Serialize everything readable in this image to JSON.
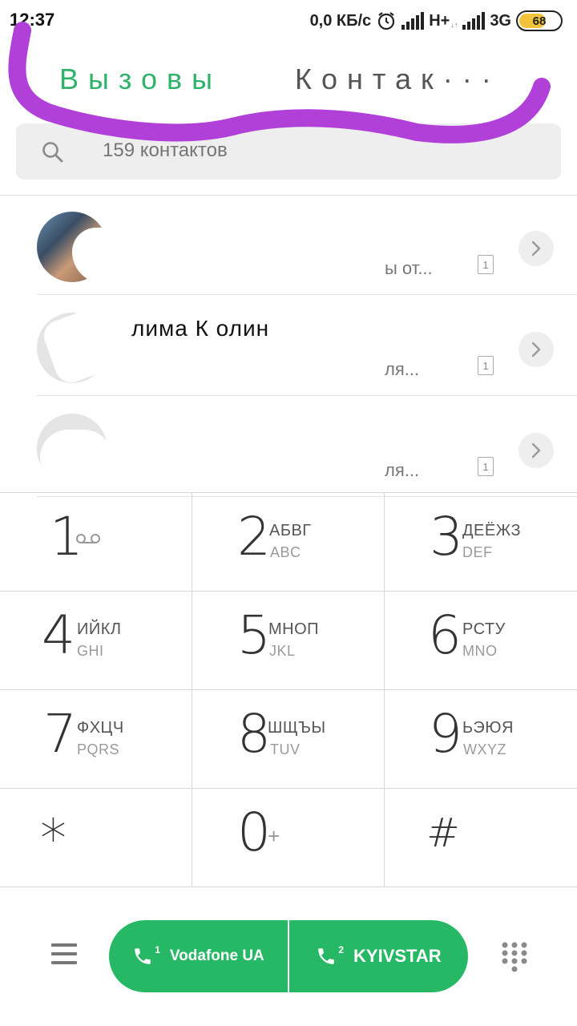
{
  "status_bar": {
    "time": "12:37",
    "speed": "0,0 КБ/с",
    "net1": "H+",
    "net2": "3G",
    "battery_level": 68
  },
  "tabs": [
    {
      "label": "Вызовы",
      "active": true
    },
    {
      "label": "Контак···",
      "active": false
    }
  ],
  "search": {
    "placeholder": "159 контактов"
  },
  "contacts": [
    {
      "name": "",
      "subtitle": "ы от...",
      "sim": "1",
      "avatar": "photo"
    },
    {
      "name": "лима К   олин",
      "subtitle": "ля...",
      "sim": "1",
      "avatar": "blank"
    },
    {
      "name": "",
      "subtitle": "ля...",
      "sim": "1",
      "avatar": "blank"
    }
  ],
  "dialpad": [
    {
      "digit": "1",
      "letters": "",
      "latin": "",
      "icon": "voicemail-icon"
    },
    {
      "digit": "2",
      "letters": "АБВГ",
      "latin": "ABC"
    },
    {
      "digit": "3",
      "letters": "ДЕЁЖЗ",
      "latin": "DEF"
    },
    {
      "digit": "4",
      "letters": "ИЙКЛ",
      "latin": "GHI"
    },
    {
      "digit": "5",
      "letters": "МНОП",
      "latin": "JKL"
    },
    {
      "digit": "6",
      "letters": "РСТУ",
      "latin": "MNO"
    },
    {
      "digit": "7",
      "letters": "ФХЦЧ",
      "latin": "PQRS"
    },
    {
      "digit": "8",
      "letters": "ШЩЪЫ",
      "latin": "TUV"
    },
    {
      "digit": "9",
      "letters": "ЬЭЮЯ",
      "latin": "WXYZ"
    },
    {
      "digit": "*",
      "letters": "",
      "latin": ""
    },
    {
      "digit": "0",
      "letters": "+",
      "latin": ""
    },
    {
      "digit": "#",
      "letters": "",
      "latin": ""
    }
  ],
  "call_buttons": {
    "sim1": {
      "num": "1",
      "label": "Vodafone UA"
    },
    "sim2": {
      "num": "2",
      "label": "KYIVSTAR"
    }
  },
  "colors": {
    "accent_green": "#2fb36a",
    "call_green": "#26b865",
    "battery_yellow": "#f2c23a",
    "scribble_purple": "#b040d8"
  }
}
